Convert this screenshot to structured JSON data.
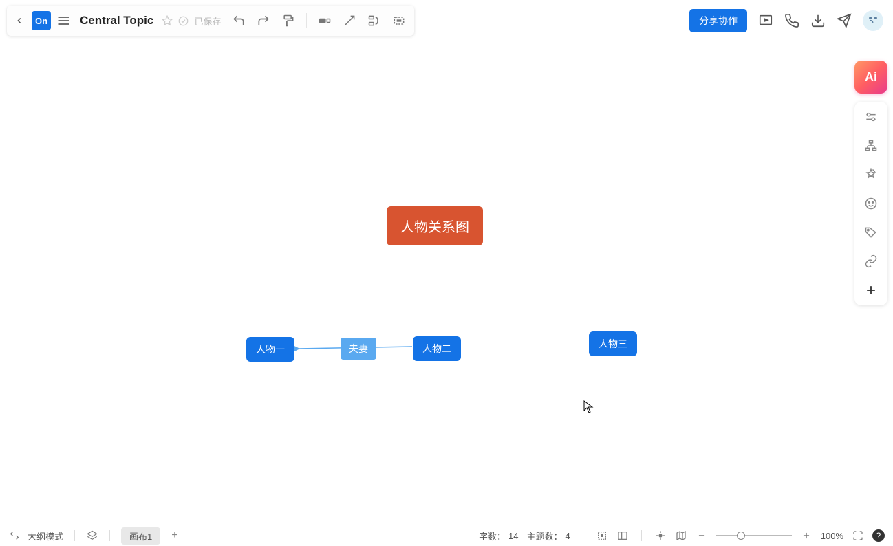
{
  "toolbar": {
    "logo_text": "On",
    "title": "Central Topic",
    "save_status": "已保存"
  },
  "top_right": {
    "share_label": "分享协作"
  },
  "ai_label": "Ai",
  "nodes": {
    "central": "人物关系图",
    "person1": "人物一",
    "person2": "人物二",
    "person3": "人物三",
    "relation": "夫妻"
  },
  "bottom": {
    "outline_mode": "大纲模式",
    "canvas_tab": "画布1",
    "char_count_label": "字数：",
    "char_count": "14",
    "topic_count_label": "主题数：",
    "topic_count": "4",
    "zoom": "100%"
  }
}
